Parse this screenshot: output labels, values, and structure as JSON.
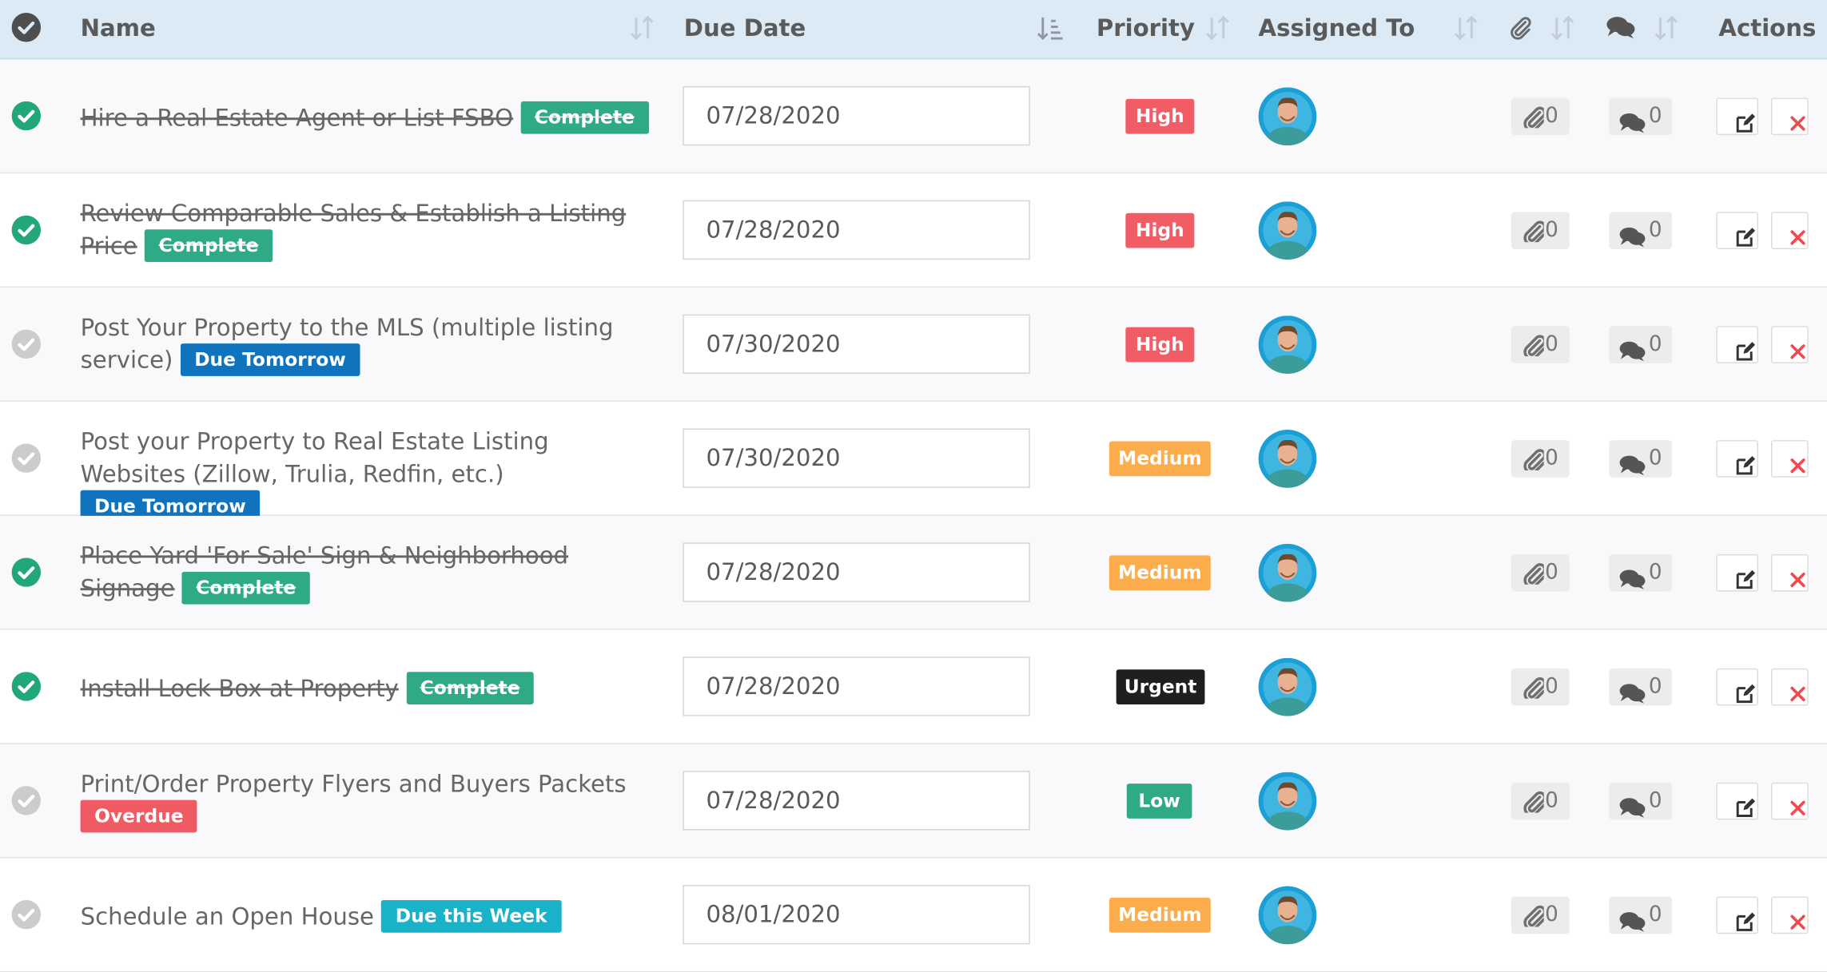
{
  "header": {
    "name": "Name",
    "due_date": "Due Date",
    "priority": "Priority",
    "assigned_to": "Assigned To",
    "actions": "Actions"
  },
  "rows": [
    {
      "name": "Hire a Real Estate Agent or List FSBO",
      "status": "Complete",
      "completed": true,
      "due": "07/28/2020",
      "priority": "High",
      "attachments": "0",
      "comments": "0"
    },
    {
      "name": "Review Comparable Sales & Establish a Listing Price",
      "status": "Complete",
      "completed": true,
      "due": "07/28/2020",
      "priority": "High",
      "attachments": "0",
      "comments": "0"
    },
    {
      "name": "Post Your Property to the MLS (multiple listing service)",
      "status": "Due Tomorrow",
      "completed": false,
      "due": "07/30/2020",
      "priority": "High",
      "attachments": "0",
      "comments": "0"
    },
    {
      "name": "Post your Property to Real Estate Listing Websites (Zillow, Trulia, Redfin, etc.)",
      "status": "Due Tomorrow",
      "completed": false,
      "due": "07/30/2020",
      "priority": "Medium",
      "attachments": "0",
      "comments": "0"
    },
    {
      "name": "Place Yard 'For Sale' Sign & Neighborhood Signage",
      "status": "Complete",
      "completed": true,
      "due": "07/28/2020",
      "priority": "Medium",
      "attachments": "0",
      "comments": "0"
    },
    {
      "name": "Install Lock Box at Property",
      "status": "Complete",
      "completed": true,
      "due": "07/28/2020",
      "priority": "Urgent",
      "attachments": "0",
      "comments": "0"
    },
    {
      "name": "Print/Order Property Flyers and Buyers Packets",
      "status": "Overdue",
      "completed": false,
      "due": "07/28/2020",
      "priority": "Low",
      "attachments": "0",
      "comments": "0"
    },
    {
      "name": "Schedule an Open House",
      "status": "Due this Week",
      "completed": false,
      "due": "08/01/2020",
      "priority": "Medium",
      "attachments": "0",
      "comments": "0"
    }
  ],
  "colors": {
    "header_bg": "#dbeaf5",
    "complete": "#2faa87",
    "due_tomorrow": "#0f73bd",
    "overdue": "#f05b63",
    "due_this_week": "#19b2c9",
    "high": "#f25c65",
    "medium": "#fbad4d",
    "urgent": "#1f1f1f",
    "low": "#2faa87",
    "check_done": "#22a77c",
    "check_todo": "#cccccc"
  },
  "icons": {
    "select_all": "check-circle-icon",
    "sort": "sort-icon",
    "attachment": "paperclip-icon",
    "comment": "comments-icon",
    "edit": "edit-icon",
    "delete": "close-icon"
  }
}
